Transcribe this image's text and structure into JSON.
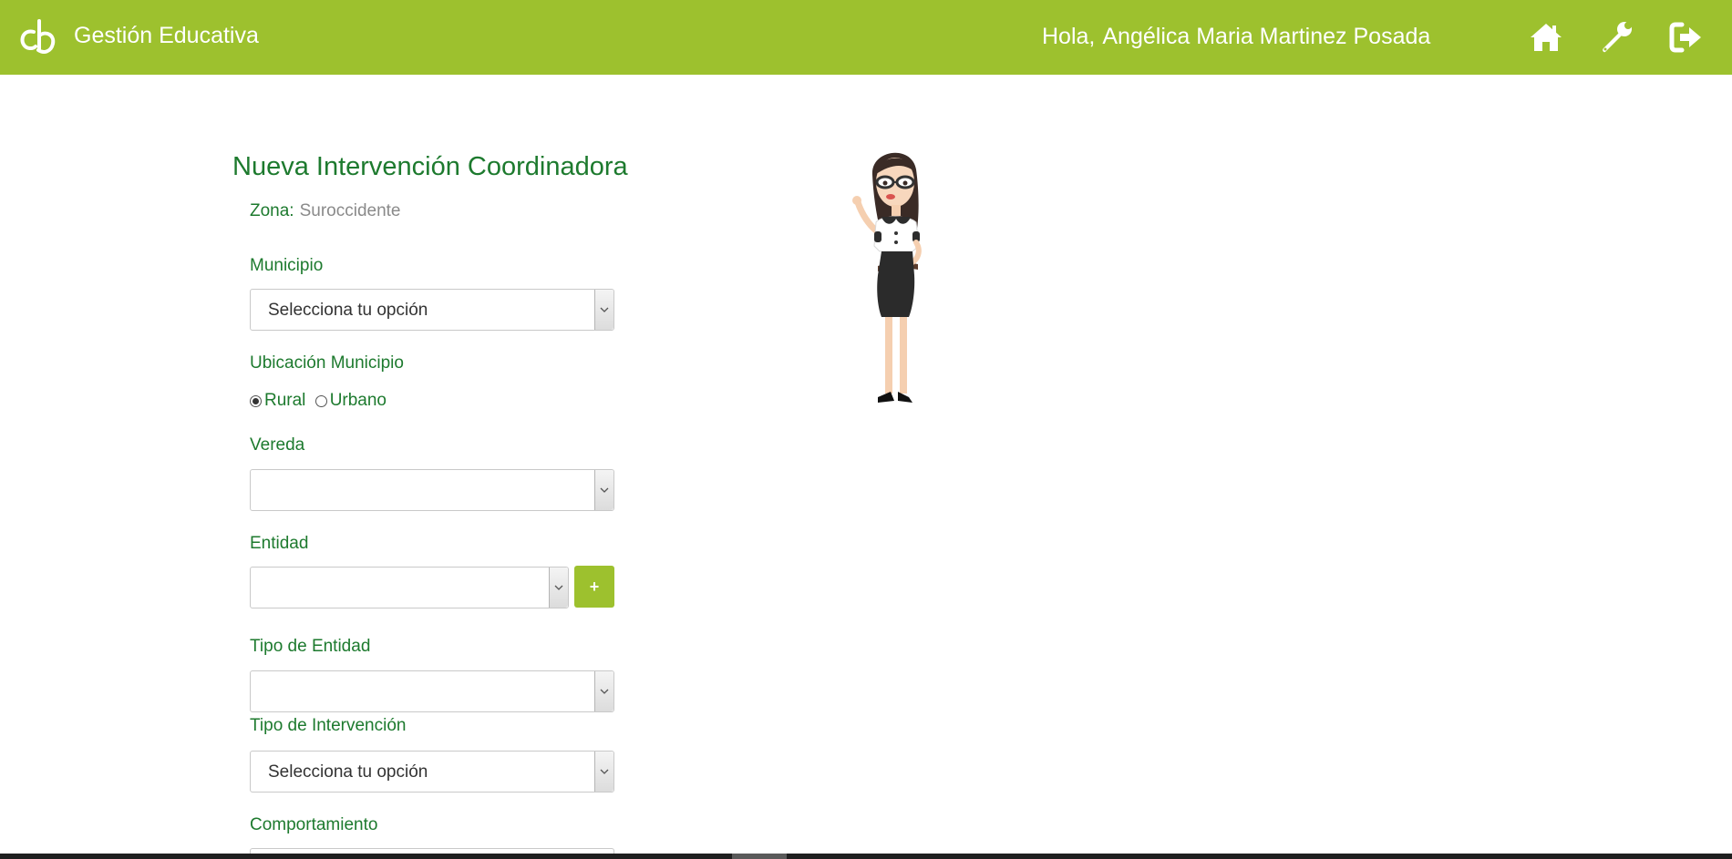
{
  "header": {
    "app_title": "Gestión Educativa",
    "greeting_prefix": "Hola,",
    "user_name": "Angélica Maria Martinez Posada",
    "icons": [
      "logo-icon",
      "home-icon",
      "wrench-icon",
      "logout-icon"
    ],
    "color": "#9dc12e"
  },
  "form": {
    "title": "Nueva Intervención Coordinadora",
    "zona_label": "Zona:",
    "zona_value": "Suroccidente",
    "municipio": {
      "label": "Municipio",
      "value": "Selecciona tu opción"
    },
    "ubicacion": {
      "label": "Ubicación Municipio",
      "options": [
        {
          "label": "Rural",
          "checked": true
        },
        {
          "label": "Urbano",
          "checked": false
        }
      ]
    },
    "vereda": {
      "label": "Vereda",
      "value": ""
    },
    "entidad": {
      "label": "Entidad",
      "value": "",
      "add_label": "+"
    },
    "tipo_entidad": {
      "label": "Tipo de Entidad",
      "value": ""
    },
    "tipo_intervencion": {
      "label": "Tipo de Intervención",
      "value": "Selecciona tu opción"
    },
    "comportamiento": {
      "label": "Comportamiento"
    }
  },
  "colors": {
    "accent": "#9dc12e",
    "label_green": "#1d7a2e",
    "muted": "#8a8a8a"
  }
}
